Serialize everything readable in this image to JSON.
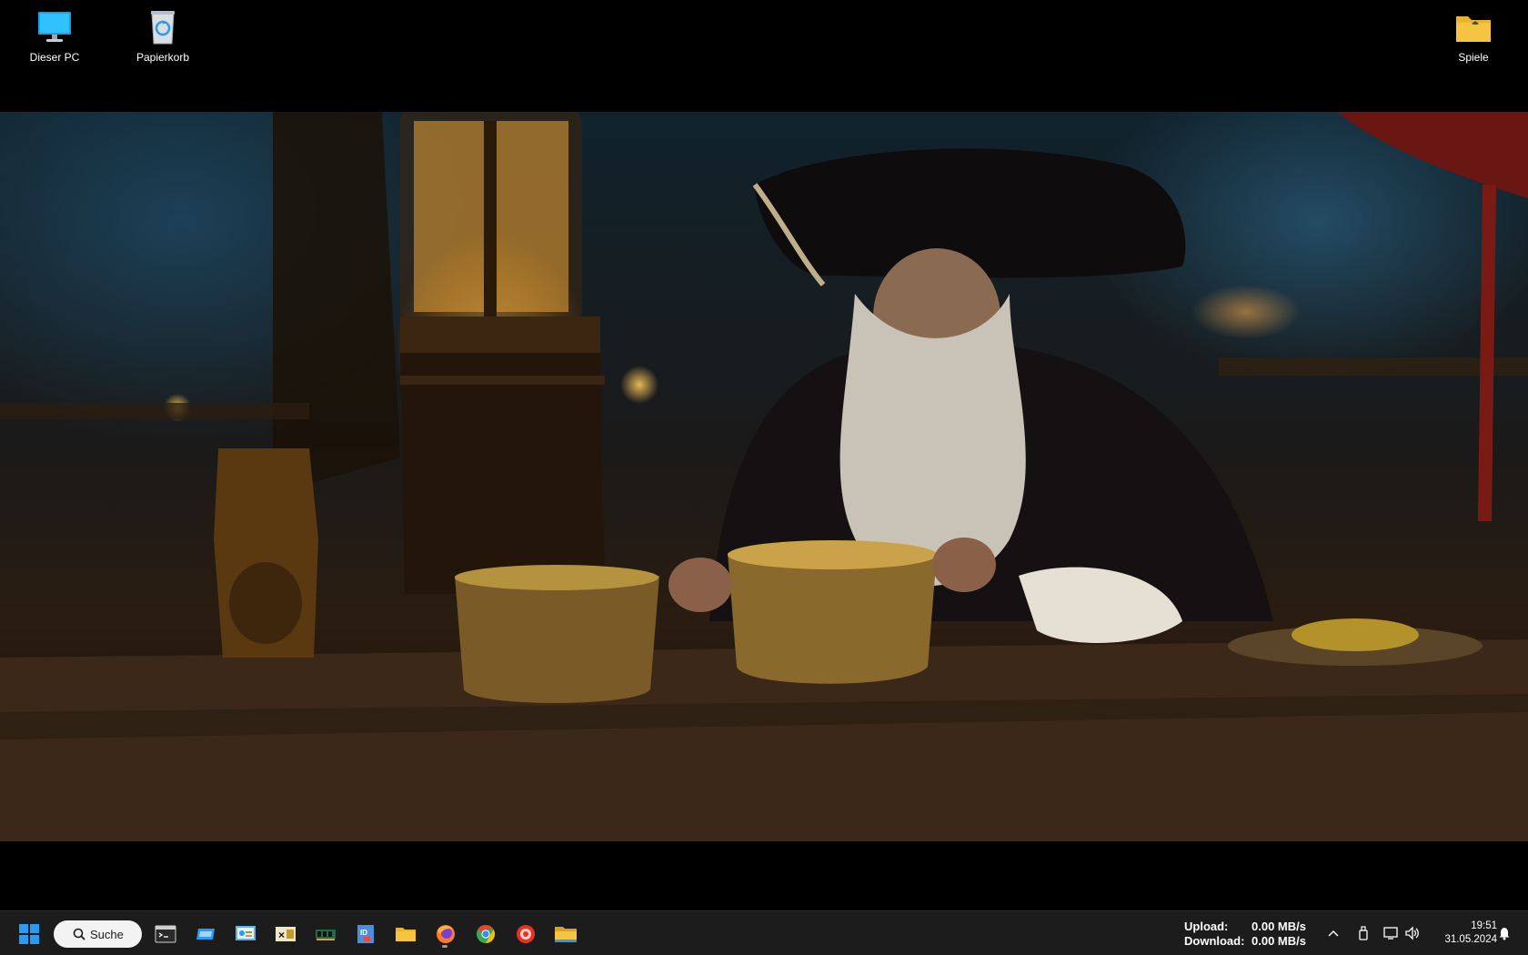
{
  "desktop": {
    "icons": [
      {
        "label": "Dieser PC",
        "icon": "monitor-icon"
      },
      {
        "label": "Papierkorb",
        "icon": "recycle-bin-icon"
      },
      {
        "label": "Spiele",
        "icon": "folder-icon"
      }
    ],
    "wallpaper": "pirate-captain-tavern-wallpaper"
  },
  "taskbar": {
    "search_label": "Suche",
    "apps": [
      {
        "icon": "start-windows-icon"
      },
      {
        "icon": "terminal-icon"
      },
      {
        "icon": "blue-app-icon"
      },
      {
        "icon": "control-panel-icon"
      },
      {
        "icon": "excel-ix-icon"
      },
      {
        "icon": "memory-chip-icon"
      },
      {
        "icon": "id-app-icon"
      },
      {
        "icon": "file-explorer-icon"
      },
      {
        "icon": "firefox-icon"
      },
      {
        "icon": "chrome-icon"
      },
      {
        "icon": "red-circle-app-icon"
      },
      {
        "icon": "folder-taskbar-icon"
      }
    ],
    "net_meter": {
      "upload_label": "Upload:",
      "upload_value": "0.00 MB/s",
      "download_label": "Download:",
      "download_value": "0.00 MB/s"
    },
    "tray": [
      "chevron-up-icon",
      "usb-icon",
      "network-icon",
      "volume-icon"
    ],
    "clock": {
      "time": "19:51",
      "date": "31.05.2024"
    },
    "notification_icon": "bell-icon"
  },
  "colors": {
    "taskbar_bg": "#1c1c1c",
    "windows_blue": "#2b9af3",
    "folder_yellow": "#f5c542"
  }
}
